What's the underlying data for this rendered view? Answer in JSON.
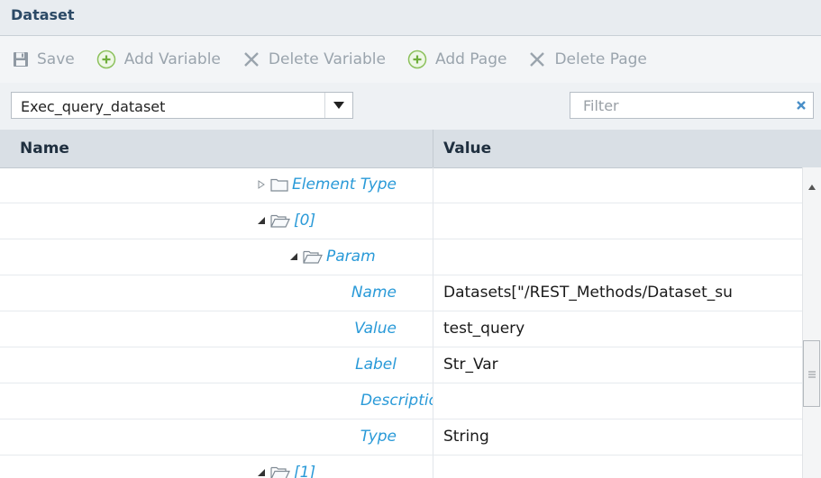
{
  "panel": {
    "title": "Dataset"
  },
  "toolbar": {
    "buttons": [
      {
        "label": "Save",
        "icon": "floppy-disk-icon"
      },
      {
        "label": "Add Variable",
        "icon": "plus-circle-icon"
      },
      {
        "label": "Delete Variable",
        "icon": "x-icon"
      },
      {
        "label": "Add Page",
        "icon": "plus-circle-icon"
      },
      {
        "label": "Delete Page",
        "icon": "x-icon"
      }
    ]
  },
  "dataset_select": {
    "value": "Exec_query_dataset",
    "icon": "dropdown-arrow-icon"
  },
  "filter": {
    "placeholder": "Filter",
    "value": "",
    "clear_icon": "clear-x-icon"
  },
  "grid": {
    "columns": [
      "Name",
      "Value"
    ],
    "rows": [
      {
        "kind": "node",
        "label": "Element Type",
        "expander": "collapsed",
        "folder": "closed",
        "value": ""
      },
      {
        "kind": "node",
        "label": "[0]",
        "expander": "expanded",
        "folder": "open",
        "value": ""
      },
      {
        "kind": "node",
        "label": "Param",
        "expander": "expanded",
        "folder": "open",
        "value": ""
      },
      {
        "kind": "prop",
        "label": "Name",
        "value": "Datasets[\"/REST_Methods/Dataset_su"
      },
      {
        "kind": "prop",
        "label": "Value",
        "value": "test_query"
      },
      {
        "kind": "prop",
        "label": "Label",
        "value": "Str_Var"
      },
      {
        "kind": "prop",
        "label": "Descriptio",
        "value": ""
      },
      {
        "kind": "prop",
        "label": "Type",
        "value": "String"
      },
      {
        "kind": "node",
        "label": "[1]",
        "expander": "expanded",
        "folder": "open",
        "value": ""
      }
    ]
  },
  "scrollbar": {
    "up_icon": "scroll-up-arrow-icon",
    "thumb_icon": "grip-icon"
  },
  "colors": {
    "link": "#2a9ad8",
    "header_bg": "#d9dfe5",
    "toolbar_text": "#9aa4ad"
  }
}
